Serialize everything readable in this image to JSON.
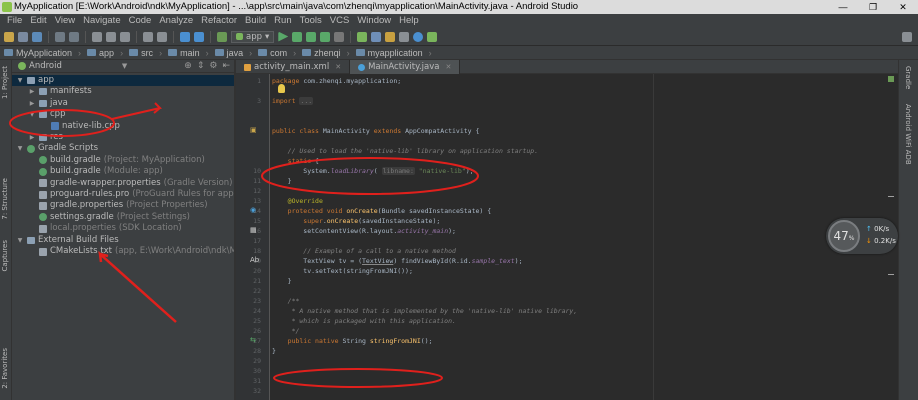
{
  "window": {
    "title": "MyApplication [E:\\Work\\Android\\ndk\\MyApplication] - ...\\app\\src\\main\\java\\com\\zhenqi\\myapplication\\MainActivity.java - Android Studio",
    "controls": [
      "—",
      "❐",
      "✕"
    ]
  },
  "menu": [
    "File",
    "Edit",
    "View",
    "Navigate",
    "Code",
    "Analyze",
    "Refactor",
    "Build",
    "Run",
    "Tools",
    "VCS",
    "Window",
    "Help"
  ],
  "toolbar": {
    "run_config": "app"
  },
  "breadcrumb": [
    "MyApplication",
    "app",
    "src",
    "main",
    "java",
    "com",
    "zhenqi",
    "myapplication"
  ],
  "project_panel": {
    "view_selector": "Android",
    "tree": [
      {
        "label": "app",
        "hint": "",
        "icon": "folder",
        "depth": 0,
        "arrow": "▼",
        "selected": true
      },
      {
        "label": "manifests",
        "hint": "",
        "icon": "folder",
        "depth": 1,
        "arrow": "▶"
      },
      {
        "label": "java",
        "hint": "",
        "icon": "folder",
        "depth": 1,
        "arrow": "▶"
      },
      {
        "label": "cpp",
        "hint": "",
        "icon": "folder",
        "depth": 1,
        "arrow": "▼"
      },
      {
        "label": "native-lib.cpp",
        "hint": "",
        "icon": "cpp",
        "depth": 2,
        "arrow": ""
      },
      {
        "label": "res",
        "hint": "",
        "icon": "folder",
        "depth": 1,
        "arrow": "▶"
      },
      {
        "label": "Gradle Scripts",
        "hint": "",
        "icon": "gradle",
        "depth": 0,
        "arrow": "▼"
      },
      {
        "label": "build.gradle",
        "hint": "(Project: MyApplication)",
        "icon": "gradle",
        "depth": 1,
        "arrow": ""
      },
      {
        "label": "build.gradle",
        "hint": "(Module: app)",
        "icon": "gradle",
        "depth": 1,
        "arrow": ""
      },
      {
        "label": "gradle-wrapper.properties",
        "hint": "(Gradle Version)",
        "icon": "file",
        "depth": 1,
        "arrow": ""
      },
      {
        "label": "proguard-rules.pro",
        "hint": "(ProGuard Rules for app)",
        "icon": "file",
        "depth": 1,
        "arrow": ""
      },
      {
        "label": "gradle.properties",
        "hint": "(Project Properties)",
        "icon": "file",
        "depth": 1,
        "arrow": ""
      },
      {
        "label": "settings.gradle",
        "hint": "(Project Settings)",
        "icon": "gradle",
        "depth": 1,
        "arrow": ""
      },
      {
        "label": "local.properties",
        "hint": "(SDK Location)",
        "icon": "file",
        "depth": 1,
        "arrow": "",
        "dim": true
      },
      {
        "label": "External Build Files",
        "hint": "",
        "icon": "folder",
        "depth": 0,
        "arrow": "▼"
      },
      {
        "label": "CMakeLists.txt",
        "hint": "(app, E:\\Work\\Android\\ndk\\MyApplica",
        "icon": "file",
        "depth": 1,
        "arrow": ""
      }
    ]
  },
  "side_tabs": {
    "left": [
      "1: Project",
      "7: Structure",
      "Captures",
      "2: Favorites"
    ],
    "right": [
      "Gradle",
      "Android WiFi ADB"
    ]
  },
  "editor_tabs": [
    {
      "label": "activity_main.xml",
      "active": false,
      "color": "#e0a040"
    },
    {
      "label": "MainActivity.java",
      "active": true,
      "color": "#4a9fd8"
    }
  ],
  "editor": {
    "line_numbers": [
      "1",
      "",
      "3",
      "",
      "",
      "",
      "",
      "",
      "",
      "10",
      "11",
      "12",
      "13",
      "14",
      "15",
      "16",
      "17",
      "18",
      "19",
      "20",
      "21",
      "22",
      "23",
      "24",
      "25",
      "26",
      "27",
      "28",
      "29",
      "30",
      "31",
      "32"
    ],
    "lines": [
      [
        {
          "c": "kw",
          "t": "package "
        },
        {
          "c": "",
          "t": "com.zhenqi.myapplication;"
        }
      ],
      [
        {
          "c": "",
          "t": ""
        }
      ],
      [
        {
          "c": "kw",
          "t": "import "
        },
        {
          "c": "hint",
          "t": "..."
        }
      ],
      [
        {
          "c": "",
          "t": ""
        }
      ],
      [
        {
          "c": "",
          "t": ""
        }
      ],
      [
        {
          "c": "kw",
          "t": "public class "
        },
        {
          "c": "",
          "t": "MainActivity "
        },
        {
          "c": "kw",
          "t": "extends "
        },
        {
          "c": "",
          "t": "AppCompatActivity {"
        }
      ],
      [
        {
          "c": "",
          "t": ""
        }
      ],
      [
        {
          "c": "cm",
          "t": "    // Used to load the 'native-lib' library on application startup."
        }
      ],
      [
        {
          "c": "kw",
          "t": "    static "
        },
        {
          "c": "",
          "t": "{"
        }
      ],
      [
        {
          "c": "",
          "t": "        System."
        },
        {
          "c": "fld2",
          "t": "loadLibrary"
        },
        {
          "c": "",
          "t": "( "
        },
        {
          "c": "hint",
          "t": "libname:"
        },
        {
          "c": "str",
          "t": " \"native-lib\""
        },
        {
          "c": "",
          "t": ");"
        }
      ],
      [
        {
          "c": "",
          "t": "    }"
        }
      ],
      [
        {
          "c": "",
          "t": ""
        }
      ],
      [
        {
          "c": "an",
          "t": "    @Override"
        }
      ],
      [
        {
          "c": "kw",
          "t": "    protected void "
        },
        {
          "c": "fn",
          "t": "onCreate"
        },
        {
          "c": "",
          "t": "(Bundle savedInstanceState) {"
        }
      ],
      [
        {
          "c": "kw",
          "t": "        super"
        },
        {
          "c": "",
          "t": "."
        },
        {
          "c": "fn",
          "t": "onCreate"
        },
        {
          "c": "",
          "t": "(savedInstanceState);"
        }
      ],
      [
        {
          "c": "",
          "t": "        setContentView(R.layout."
        },
        {
          "c": "fld2",
          "t": "activity_main"
        },
        {
          "c": "",
          "t": ");"
        }
      ],
      [
        {
          "c": "",
          "t": ""
        }
      ],
      [
        {
          "c": "cm",
          "t": "        // Example of a call to a native method"
        }
      ],
      [
        {
          "c": "",
          "t": "        TextView tv = ("
        },
        {
          "c": "hl",
          "t": "TextView"
        },
        {
          "c": "",
          "t": ") findViewById(R.id."
        },
        {
          "c": "fld2",
          "t": "sample_text"
        },
        {
          "c": "",
          "t": ");"
        }
      ],
      [
        {
          "c": "",
          "t": "        tv.setText(stringFromJNI());"
        }
      ],
      [
        {
          "c": "",
          "t": "    }"
        }
      ],
      [
        {
          "c": "",
          "t": ""
        }
      ],
      [
        {
          "c": "cm",
          "t": "    /**"
        }
      ],
      [
        {
          "c": "cm",
          "t": "     * A native method that is implemented by the 'native-lib' native library,"
        }
      ],
      [
        {
          "c": "cm",
          "t": "     * which is packaged with this application."
        }
      ],
      [
        {
          "c": "cm",
          "t": "     */"
        }
      ],
      [
        {
          "c": "kw",
          "t": "    public native "
        },
        {
          "c": "",
          "t": "String "
        },
        {
          "c": "fn",
          "t": "stringFromJNI"
        },
        {
          "c": "",
          "t": "();"
        }
      ],
      [
        {
          "c": "",
          "t": "}"
        }
      ]
    ]
  },
  "net_widget": {
    "percent": "47",
    "percent_sign": "%",
    "up": "0K/s",
    "down": "0.2K/s",
    "up_arrow": "↑",
    "down_arrow": "↓"
  }
}
